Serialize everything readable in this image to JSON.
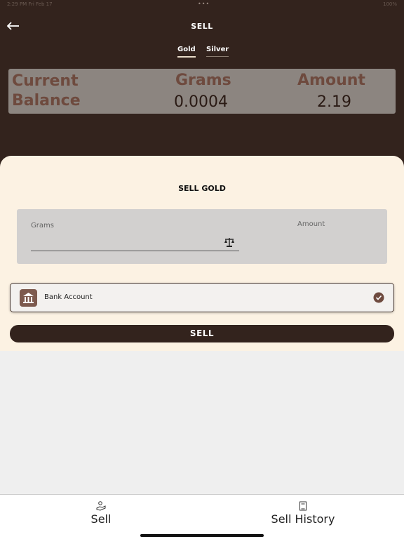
{
  "status_bar": {
    "time": "2:29 PM   Fri Feb 17",
    "dots": "•••",
    "right": "100%"
  },
  "header": {
    "title": "SELL",
    "back_icon": "arrow-left-icon"
  },
  "tabs": [
    {
      "label": "Gold",
      "active": true
    },
    {
      "label": "Silver",
      "active": false
    }
  ],
  "balance": {
    "label_line1": "Current",
    "label_line2": "Balance",
    "grams_label": "Grams",
    "grams_value": "0.0004",
    "amount_label": "Amount",
    "amount_value": "2.19"
  },
  "sell_form": {
    "title": "SELL GOLD",
    "grams_label": "Grams",
    "grams_value": "",
    "grams_icon": "scale-icon",
    "amount_label": "Amount",
    "payment_method": {
      "label": "Bank Account",
      "icon": "bank-icon",
      "selected": true
    },
    "sell_button": "SELL"
  },
  "bottom_nav": [
    {
      "label": "Sell",
      "icon": "hand-coin-icon"
    },
    {
      "label": "Sell History",
      "icon": "book-icon"
    }
  ],
  "colors": {
    "header_bg": "#33231d",
    "sheet_bg": "#fcf2e3",
    "balance_bg": "#8c8580",
    "accent_brown": "#7d5a4e",
    "button_bg": "#33231d"
  }
}
